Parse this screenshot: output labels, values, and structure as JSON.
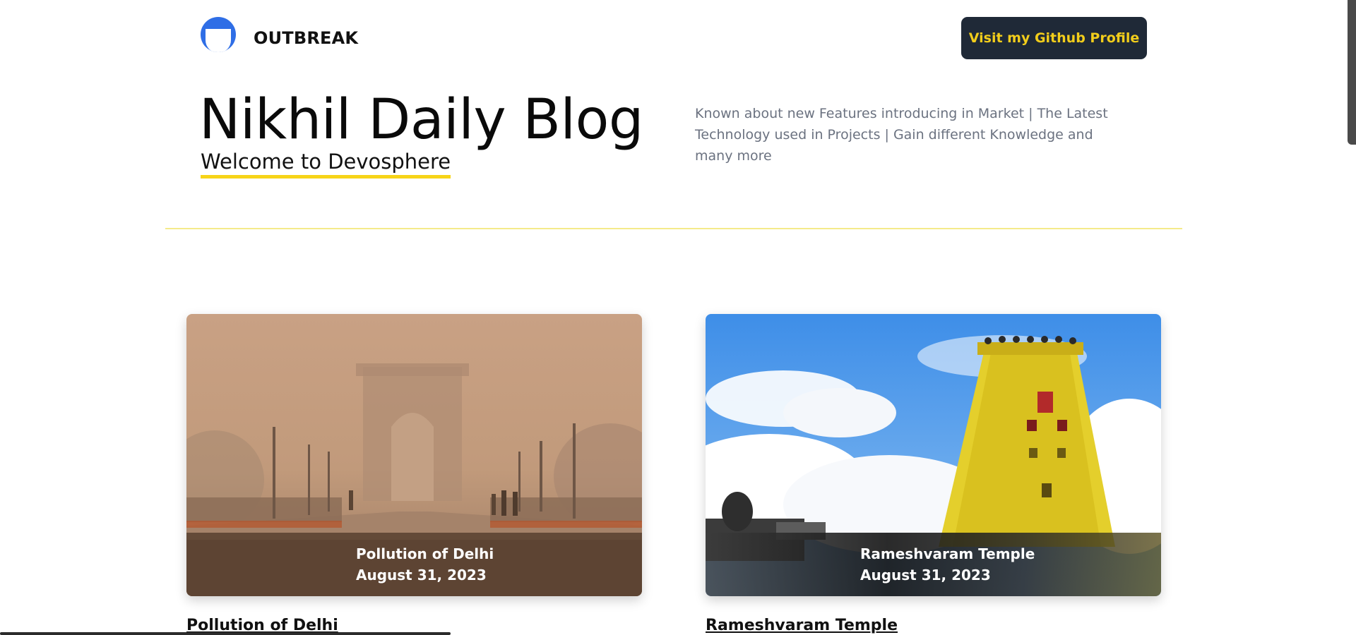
{
  "header": {
    "brand": "OUTBREAK",
    "github_button": "Visit my Github Profile"
  },
  "hero": {
    "title": "Nikhil Daily Blog",
    "subtitle": "Welcome to Devosphere",
    "description": "Known about new Features introducing in Market | The Latest Technology used in Projects | Gain different Knowledge and many more"
  },
  "posts": [
    {
      "title": "Pollution of Delhi",
      "date": "August 31, 2023",
      "link": "Pollution of Delhi"
    },
    {
      "title": "Rameshvaram Temple",
      "date": "August 31, 2023",
      "link": "Rameshvaram Temple"
    }
  ],
  "colors": {
    "logo_blue": "#2f6ee6",
    "button_bg": "#1f2937",
    "button_text": "#f2cd1b",
    "accent_yellow": "#f7d417",
    "divider": "#f5ea8a",
    "muted_text": "#6b7280"
  }
}
